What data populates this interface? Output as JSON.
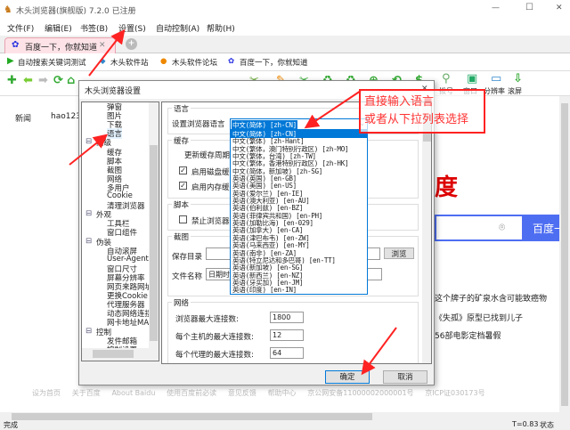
{
  "window": {
    "title": "木头浏览器(旗舰版) 7.2.0  已注册",
    "minimize": "—",
    "maximize": "☐",
    "close": "✕"
  },
  "menu": [
    "文件(F)",
    "编辑(E)",
    "书签(B)",
    "设置(S)",
    "自动控制(A)",
    "帮助(H)"
  ],
  "tab": {
    "label": "百度一下，你就知道",
    "close": "✕",
    "new": "+"
  },
  "bookmarks": [
    "自动搜索关键词测试",
    "木头软件站",
    "木头软件论坛",
    "百度一下，你就知道"
  ],
  "toolbar": {
    "labels": [
      "拨号",
      "窗口",
      "分辨率",
      "滚屏"
    ]
  },
  "page": {
    "nav": [
      "新闻",
      "hao123"
    ],
    "logo": "度",
    "search_button": "百度一下",
    "news": [
      "这个牌子的矿泉水含可能致癌物",
      "《失孤》原型已找到儿子",
      "56部电影定档暑假"
    ],
    "footer": [
      "设为首页",
      "关于百度",
      "About Baidu",
      "使用百度前必读",
      "意见反馈",
      "帮助中心",
      "京公网安备11000002000001号",
      "京ICP证030173号"
    ]
  },
  "status": {
    "left": "完成",
    "timing": "T=0.83",
    "state": "状态"
  },
  "dialog": {
    "title": "木头浏览器设置",
    "close": "✕",
    "tree": [
      {
        "label": "弹窗",
        "level": 1
      },
      {
        "label": "图片",
        "level": 1
      },
      {
        "label": "下载",
        "level": 1
      },
      {
        "label": "语言",
        "level": 1
      },
      {
        "label": "高级",
        "level": 0
      },
      {
        "label": "缓存",
        "level": 1
      },
      {
        "label": "脚本",
        "level": 1
      },
      {
        "label": "截图",
        "level": 1
      },
      {
        "label": "网络",
        "level": 1
      },
      {
        "label": "多用户",
        "level": 1
      },
      {
        "label": "Cookie",
        "level": 1
      },
      {
        "label": "清理浏览器",
        "level": 1
      },
      {
        "label": "外观",
        "level": 0
      },
      {
        "label": "工具栏",
        "level": 1
      },
      {
        "label": "窗口组件",
        "level": 1
      },
      {
        "label": "伪装",
        "level": 0
      },
      {
        "label": "自动滚屏",
        "level": 1
      },
      {
        "label": "User-Agent",
        "level": 1
      },
      {
        "label": "窗口尺寸",
        "level": 1
      },
      {
        "label": "屏幕分辨率",
        "level": 1
      },
      {
        "label": "网页来路网址",
        "level": 1
      },
      {
        "label": "更换Cookie",
        "level": 1
      },
      {
        "label": "代理服务器",
        "level": 1
      },
      {
        "label": "动态网络连接",
        "level": 1
      },
      {
        "label": "网卡地址MAC",
        "level": 1
      },
      {
        "label": "控制",
        "level": 0
      },
      {
        "label": "发件邮箱",
        "level": 1
      },
      {
        "label": "控制设置",
        "level": 1
      }
    ],
    "language": {
      "group": "语言",
      "label": "设置浏览器语言",
      "value": "中文(简体) [zh-CN]"
    },
    "cache": {
      "group": "缓存",
      "period_label": "更新缓存周期",
      "disk": "启用磁盘缓存",
      "disk_checked": true,
      "memory": "启用内存缓存",
      "memory_checked": true
    },
    "script": {
      "group": "脚本",
      "disable": "禁止浏览器运行脚本",
      "disable_checked": false
    },
    "screenshot": {
      "group": "截图",
      "dir_label": "保存目录",
      "dir_value": "",
      "browse": "浏览",
      "name_label": "文件名称",
      "name_value": "日期时间"
    },
    "network": {
      "group": "网络",
      "max_conn_label": "浏览器最大连接数:",
      "max_conn": "1800",
      "per_host_label": "每个主机的最大连接数:",
      "per_host": "12",
      "per_proxy_label": "每个代理的最大连接数:",
      "per_proxy": "64"
    },
    "ok": "确定",
    "cancel": "取消",
    "language_options": [
      "中文(简体) [zh-CN]",
      "中文(繁体) [zh-Hant]",
      "中文(繁体，澳门特别行政区) [zh-MO]",
      "中文(繁体，台湾) [zh-TW]",
      "中文(繁体，香港特别行政区) [zh-HK]",
      "中文(简体，新加坡) [zh-SG]",
      "英语(英国) [en-GB]",
      "英语(美国) [en-US]",
      "英语(爱尔兰) [en-IE]",
      "英语(澳大利亚) [en-AU]",
      "英语(伯利兹) [en-BZ]",
      "英语(菲律宾共和国) [en-PH]",
      "英语(加勒比海) [en-029]",
      "英语(加拿大) [en-CA]",
      "英语(津巴布韦) [en-ZW]",
      "英语(马来西亚) [en-MY]",
      "英语(南非) [en-ZA]",
      "英语(特立尼达和多巴哥) [en-TT]",
      "英语(新加坡) [en-SG]",
      "英语(新西兰) [en-NZ]",
      "英语(牙买加) [en-JM]",
      "英语(印度) [en-IN]"
    ]
  },
  "annotation": {
    "lines": [
      "直接输入语言",
      "或者从下拉列表选择"
    ],
    "color": "#ff2222"
  }
}
